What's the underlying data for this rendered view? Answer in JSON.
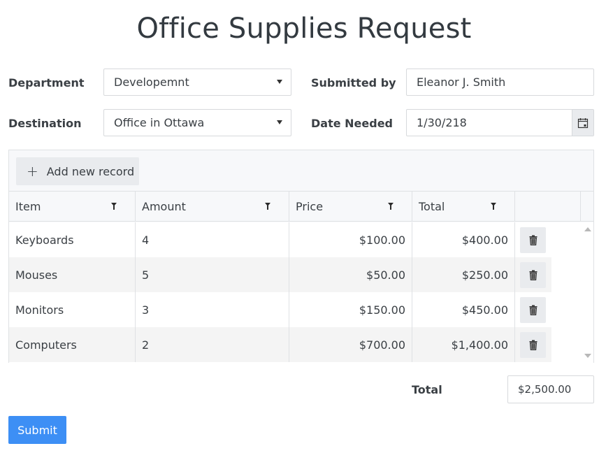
{
  "page": {
    "title": "Office Supplies Request"
  },
  "form": {
    "department": {
      "label": "Department",
      "value": "Developemnt"
    },
    "submitted_by": {
      "label": "Submitted by",
      "value": "Eleanor J. Smith"
    },
    "destination": {
      "label": "Destination",
      "value": "Office in Ottawa"
    },
    "date_needed": {
      "label": "Date Needed",
      "value": "1/30/218",
      "icon": "calendar-icon"
    }
  },
  "grid": {
    "toolbar": {
      "add_label": "Add new record",
      "add_icon": "+"
    },
    "columns": [
      "Item",
      "Amount",
      "Price",
      "Total"
    ],
    "rows": [
      {
        "item": "Keyboards",
        "amount": "4",
        "price": "$100.00",
        "total": "$400.00"
      },
      {
        "item": "Mouses",
        "amount": "5",
        "price": "$50.00",
        "total": "$250.00"
      },
      {
        "item": "Monitors",
        "amount": "3",
        "price": "$150.00",
        "total": "$450.00"
      },
      {
        "item": "Computers",
        "amount": "2",
        "price": "$700.00",
        "total": "$1,400.00"
      }
    ]
  },
  "summary": {
    "total_label": "Total",
    "total_value": "$2,500.00"
  },
  "actions": {
    "submit_label": "Submit"
  },
  "colors": {
    "primary": "#3d8ff5",
    "button_gray": "#e9ebee",
    "border": "#d7d9dc"
  }
}
